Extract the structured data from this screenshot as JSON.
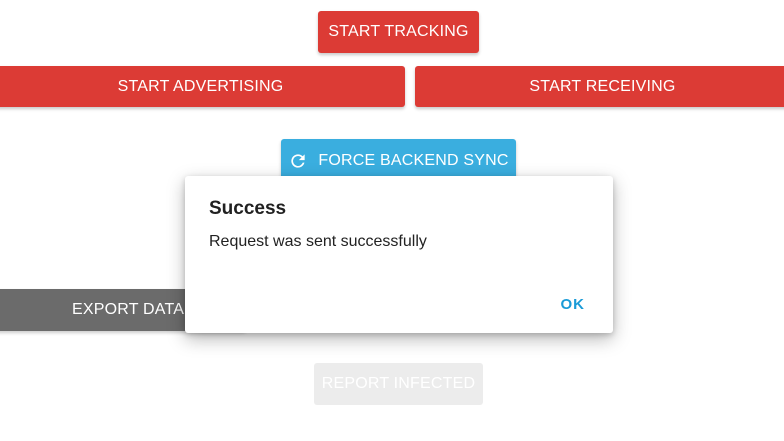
{
  "buttons": {
    "start_tracking": "START TRACKING",
    "start_advertising": "START ADVERTISING",
    "start_receiving": "START RECEIVING",
    "force_backend_sync": "FORCE BACKEND SYNC",
    "export_database": "EXPORT DATABASE",
    "report_infected": "REPORT INFECTED"
  },
  "dialog": {
    "title": "Success",
    "message": "Request was sent successfully",
    "ok_label": "OK"
  },
  "icons": {
    "sync": "refresh-icon"
  },
  "colors": {
    "primary_red": "#dc3b35",
    "sync_blue": "#3aaedf",
    "export_gray": "#6b6b6b",
    "disabled_gray": "#ececec",
    "dialog_accent": "#1a9bd7"
  }
}
